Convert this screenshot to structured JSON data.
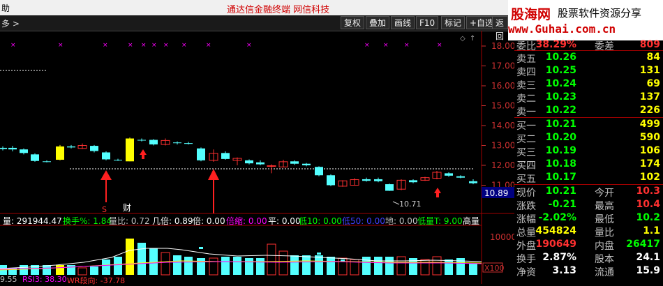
{
  "titlebar": {
    "left": "助",
    "center": "通达信金融终端    网信科技"
  },
  "toolbar": {
    "left": "多 >",
    "buttons": [
      "复权",
      "叠加",
      "画线",
      "F10",
      "标记",
      "+自选",
      "返回"
    ]
  },
  "logo": {
    "line1_a": "股海网",
    "line1_b": "股票软件资源分享",
    "line2": "www.Guhai.com.cn"
  },
  "price_axis": [
    "18.00",
    "17.00",
    "16.00",
    "15.00",
    "14.00",
    "13.00",
    "12.00",
    "11.00"
  ],
  "current_price_tag": "10.89",
  "low_label": "10.71",
  "markers": {
    "s_mark": "S",
    "cai_mark": "财"
  },
  "volume_axis": {
    "label": "10000",
    "unit": "X100"
  },
  "indicator_line": {
    "vol": "量: 291944.47",
    "turnover": "换手%: 1.84",
    "liangbi": "量比: 0.72",
    "jibei": "几倍: 0.89",
    "bei": "倍: 0.00",
    "beisuo": "倍缩: 0.00",
    "ping": "平: 0.00",
    "di10": "低10: 0.00",
    "di50": "低50: 0.00",
    "di": "地: 0.00",
    "dilt": "低量T: 9.00",
    "gaoliang": "高量"
  },
  "bottom_line": {
    "a": "9.55",
    "rsi": "RSI3: 38.30",
    "wr": "WR段向: -37.78"
  },
  "quote": {
    "header": {
      "label1": "委比",
      "value1": "38.29%",
      "label2": "委差",
      "value2": "809"
    },
    "asks": [
      {
        "label": "卖五",
        "price": "10.26",
        "qty": "84"
      },
      {
        "label": "卖四",
        "price": "10.25",
        "qty": "131"
      },
      {
        "label": "卖三",
        "price": "10.24",
        "qty": "69"
      },
      {
        "label": "卖二",
        "price": "10.23",
        "qty": "137"
      },
      {
        "label": "卖一",
        "price": "10.22",
        "qty": "226"
      }
    ],
    "bids": [
      {
        "label": "买一",
        "price": "10.21",
        "qty": "499"
      },
      {
        "label": "买二",
        "price": "10.20",
        "qty": "590"
      },
      {
        "label": "买三",
        "price": "10.19",
        "qty": "106"
      },
      {
        "label": "买四",
        "price": "10.18",
        "qty": "174"
      },
      {
        "label": "买五",
        "price": "10.17",
        "qty": "102"
      }
    ],
    "stats": [
      {
        "l1": "现价",
        "v1": "10.21",
        "c1": "green",
        "l2": "今开",
        "v2": "10.3",
        "c2": "red"
      },
      {
        "l1": "涨跌",
        "v1": "-0.21",
        "c1": "green",
        "l2": "最高",
        "v2": "10.4",
        "c2": "red"
      },
      {
        "l1": "涨幅",
        "v1": "-2.02%",
        "c1": "green",
        "l2": "最低",
        "v2": "10.2",
        "c2": "green"
      },
      {
        "l1": "总量",
        "v1": "454824",
        "c1": "yellow",
        "l2": "量比",
        "v2": "1.1",
        "c2": "yellow"
      },
      {
        "l1": "外盘",
        "v1": "190649",
        "c1": "red",
        "l2": "内盘",
        "v2": "26417",
        "c2": "green"
      },
      {
        "l1": "换手",
        "v1": "2.87%",
        "c1": "white",
        "l2": "股本",
        "v2": "24.1",
        "c2": "white"
      },
      {
        "l1": "净资",
        "v1": "3.13",
        "c1": "white",
        "l2": "流通",
        "v2": "15.9",
        "c2": "white"
      }
    ]
  },
  "colors": {
    "up": "#ff3030",
    "down": "#54ffff",
    "magenta": "#ff00ff",
    "yellow": "#ffff00"
  }
}
